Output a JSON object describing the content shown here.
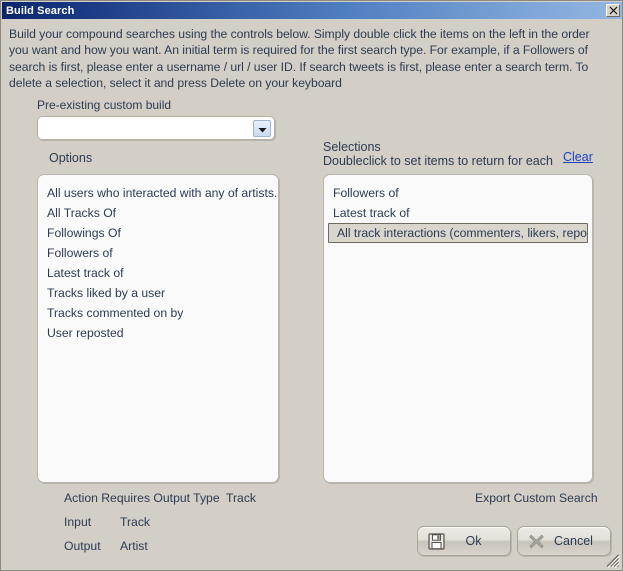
{
  "window": {
    "title": "Build Search",
    "close_icon": "close-icon"
  },
  "instructions": "Build your compound searches using the controls below. Simply double click the items on the left in the order you want and how you want.  An initial term is required for the first search type. For example, if a Followers of search is first, please enter a username / url  / user ID. If search tweets is first, please enter a search term. To delete a selection, select it and press Delete on your keyboard",
  "combo": {
    "label": "Pre-existing custom build",
    "value": "",
    "placeholder": "",
    "arrow_icon": "chevron-down-icon"
  },
  "options": {
    "label": "Options",
    "items": [
      "All users who interacted with any of artists...",
      "All Tracks Of",
      "Followings Of",
      "Followers of",
      "Latest track of",
      "Tracks liked by a user",
      "Tracks commented on by",
      "User reposted"
    ]
  },
  "selections": {
    "label": "Selections",
    "sublabel": "Doubleclick to set items to return for each",
    "clear_label": "Clear",
    "items": [
      {
        "text": "Followers of",
        "selected": false
      },
      {
        "text": "Latest track of",
        "selected": false
      },
      {
        "text": "All track interactions (commenters, likers, repost...",
        "selected": true
      }
    ]
  },
  "info": {
    "action_label": "Action Requires Output Type",
    "action_value": "Track",
    "input_label": "Input",
    "input_value": "Track",
    "output_label": "Output",
    "output_value": "Artist",
    "export_label": "Export Custom Search"
  },
  "buttons": {
    "ok_label": "Ok",
    "ok_icon": "save-floppy-icon",
    "cancel_label": "Cancel",
    "cancel_icon": "cancel-x-icon"
  },
  "colors": {
    "title_start": "#0a246a",
    "title_end": "#93b6e2",
    "dialog_bg": "#d3cfc6",
    "listbox_bg": "#fafafa",
    "text": "#2d3b52",
    "link": "#1b43c6"
  }
}
